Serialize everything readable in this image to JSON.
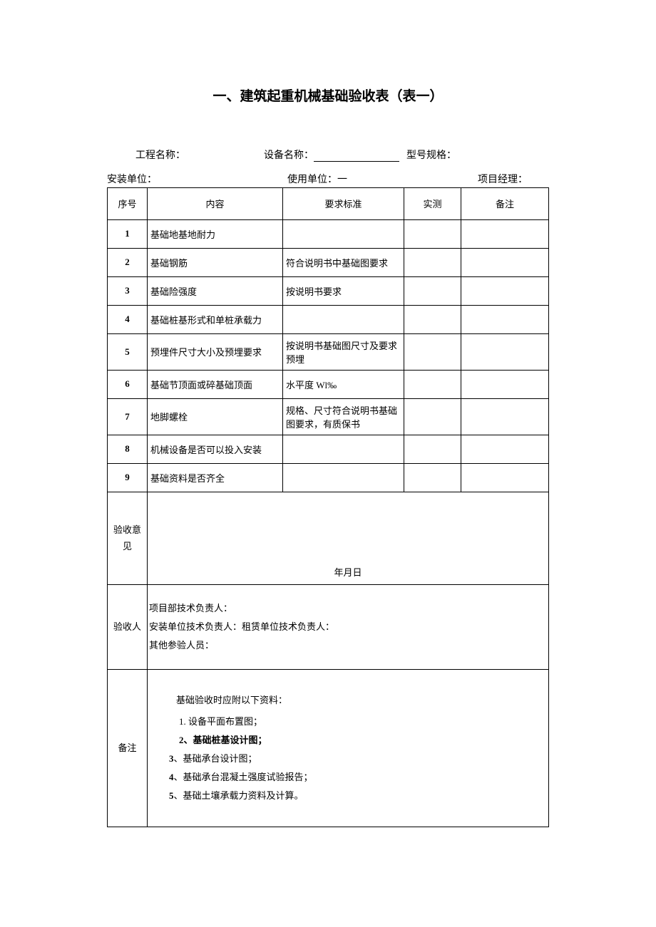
{
  "title": "一、建筑起重机械基础验收表（表一）",
  "info": {
    "project_label": "工程名称：",
    "equip_name_label": "设备名称：",
    "model_label": "型号规格：",
    "install_unit_label": "安装单位：",
    "use_unit_label": "使用单位：一",
    "pm_label": "项目经理：",
    "project_value": "",
    "equip_name_value": "",
    "model_value": "",
    "install_unit_value": "",
    "use_unit_value": "",
    "pm_value": ""
  },
  "headers": {
    "seq": "序号",
    "content": "内容",
    "standard": "要求标准",
    "measured": "实测",
    "remark": "备注"
  },
  "rows": [
    {
      "seq": "1",
      "content": "基础地基地耐力",
      "standard": "",
      "measured": "",
      "remark": ""
    },
    {
      "seq": "2",
      "content": "基础钢筋",
      "standard": "符合说明书中基础图要求",
      "measured": "",
      "remark": ""
    },
    {
      "seq": "3",
      "content": "基础险强度",
      "standard": "按说明书要求",
      "measured": "",
      "remark": ""
    },
    {
      "seq": "4",
      "content": "基础桩基形式和单桩承载力",
      "standard": "",
      "measured": "",
      "remark": ""
    },
    {
      "seq": "5",
      "content": "预埋件尺寸大小及预埋要求",
      "standard": "按说明书基础图尺寸及要求预埋",
      "measured": "",
      "remark": ""
    },
    {
      "seq": "6",
      "content": "基础节顶面或碎基础顶面",
      "standard": "水平度 Wl‰",
      "measured": "",
      "remark": ""
    },
    {
      "seq": "7",
      "content": "地脚螺栓",
      "standard": "规格、尺寸符合说明书基础图要求，有质保书",
      "measured": "",
      "remark": ""
    },
    {
      "seq": "8",
      "content": "机械设备是否可以投入安装",
      "standard": "",
      "measured": "",
      "remark": ""
    },
    {
      "seq": "9",
      "content": "基础资料是否齐全",
      "standard": "",
      "measured": "",
      "remark": ""
    }
  ],
  "opinion": {
    "label": "验收意见",
    "date": "年月日"
  },
  "inspector": {
    "label": "验收人",
    "line1": "项目部技术负责人：",
    "line2": "安装单位技术负责人：租赁单位技术负责人：",
    "line3": "其他参验人员："
  },
  "remarks": {
    "label": "备注",
    "lead": "基础验收时应附以下资料：",
    "items": [
      "1. 设备平面布置图；",
      "2、基础桩基设计图；",
      "3、基础承台设计图；",
      "4、基础承台混凝土强度试验报告；",
      "5、基础土壤承载力资料及计算。"
    ]
  }
}
